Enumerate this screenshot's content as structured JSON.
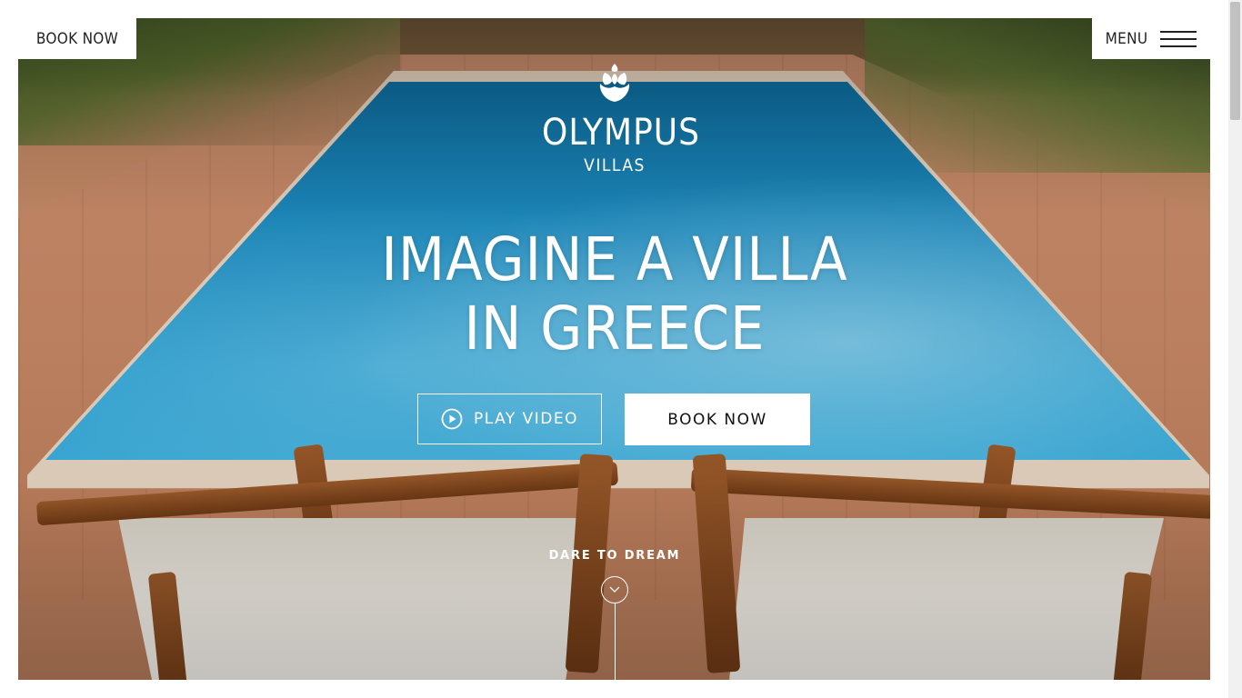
{
  "header": {
    "book_now": "BOOK NOW",
    "menu": "MENU",
    "menu_icon": "hamburger-icon"
  },
  "logo": {
    "icon": "pinecone-logo-icon",
    "name": "OLYMPUS",
    "subtitle": "VILLAS"
  },
  "hero": {
    "headline_line1": "IMAGINE A VILLA",
    "headline_line2": "IN GREECE",
    "background": "pool-with-deckchairs-photo",
    "play_video_label": "PLAY VIDEO",
    "play_icon": "play-circle-icon",
    "book_now_label": "BOOK NOW",
    "tagline": "DARE TO DREAM",
    "scroll_icon": "chevron-down-icon"
  },
  "colors": {
    "overlay_text": "#ffffff",
    "button_bg": "#ffffff",
    "button_text": "#111111",
    "pool_blue": "#2ea4d6"
  }
}
